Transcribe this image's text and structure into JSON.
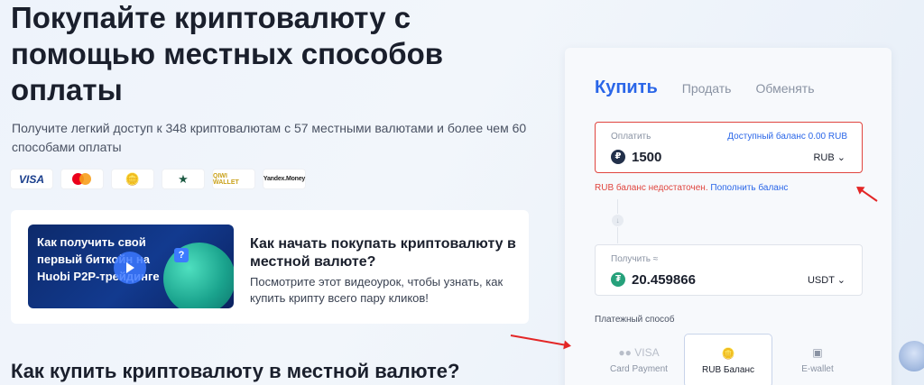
{
  "hero": {
    "title": "Покупайте криптовалюту с помощью местных способов оплаты",
    "subtitle": "Получите легкий доступ к 348 криптовалютам с 57 местными валютами и более чем 60 способами оплаты"
  },
  "payment_logos": [
    {
      "name": "visa",
      "text": "VISA"
    },
    {
      "name": "mastercard",
      "text": ""
    },
    {
      "name": "coins",
      "text": "🪙"
    },
    {
      "name": "star",
      "text": "★"
    },
    {
      "name": "qiwi",
      "text": "QIWI WALLET"
    },
    {
      "name": "yandex-money",
      "text": "Yandex.Money"
    }
  ],
  "video": {
    "thumb_text": "Как получить свой первый биткойн на Huobi P2P-трейдинге",
    "title": "Как начать покупать криптовалюту в местной валюте?",
    "description": "Посмотрите этот видеоурок, чтобы узнать, как купить крипту всего пару кликов!"
  },
  "section_title": "Как купить криптовалюту в местной валюте?",
  "widget": {
    "tabs": [
      "Купить",
      "Продать",
      "Обменять"
    ],
    "pay": {
      "label": "Оплатить",
      "balance": "Доступный баланс 0.00 RUB",
      "value": "1500",
      "currency": "RUB"
    },
    "error": {
      "text": "RUB баланс недостаточен.",
      "link": "Пополнить баланс"
    },
    "receive": {
      "label": "Получить ≈",
      "value": "20.459866",
      "currency": "USDT"
    },
    "payment_method_label": "Платежный способ",
    "payment_methods": [
      {
        "name": "Card Payment",
        "icon": "●● VISA"
      },
      {
        "name": "RUB Баланс",
        "icon": "🪙"
      },
      {
        "name": "E-wallet",
        "icon": "▣"
      }
    ]
  },
  "colors": {
    "accent": "#2a66e8",
    "error": "#e0453f",
    "annotation_arrow": "#e32626"
  }
}
